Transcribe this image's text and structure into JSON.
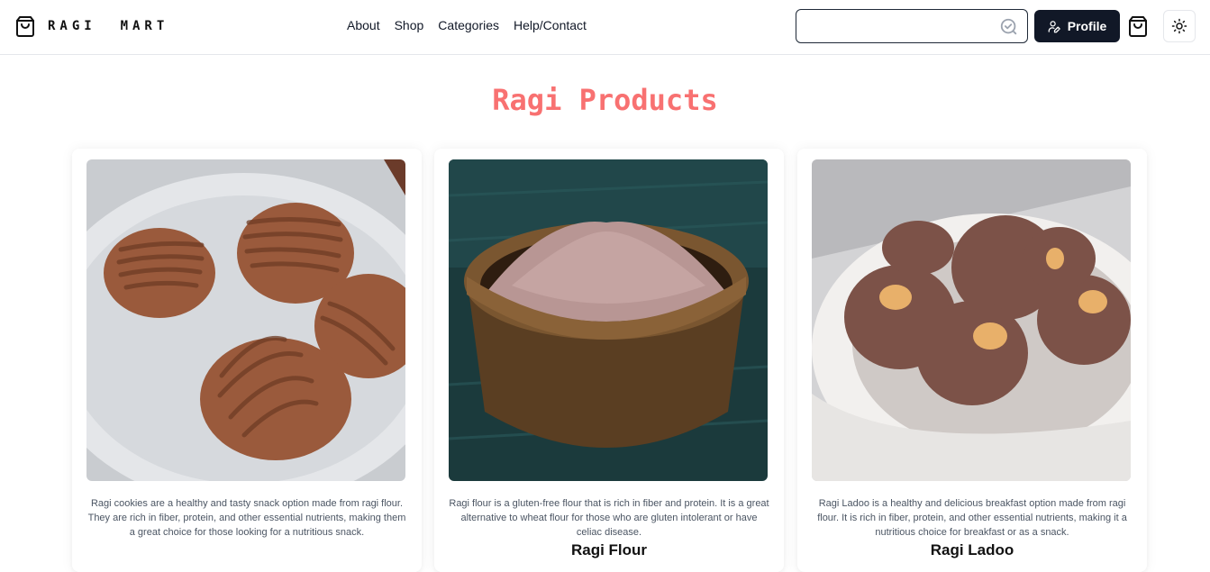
{
  "header": {
    "brand_name": "RAGI  MART",
    "brand_icon": "shopping-bag-icon",
    "nav": [
      "About",
      "Shop",
      "Categories",
      "Help/Contact"
    ],
    "search": {
      "value": "",
      "placeholder": "",
      "icon": "search-check-icon"
    },
    "profile_label": "Profile",
    "profile_icon": "user-pen-icon",
    "cart_icon": "shopping-bag-icon",
    "theme_icon": "sun-icon"
  },
  "main": {
    "title": "Ragi Products",
    "title_color": "#f87171",
    "products": [
      {
        "name": "",
        "image": "ragi-cookies-photo",
        "description": "Ragi cookies are a healthy and tasty snack option made from ragi flour. They are rich in fiber, protein, and other essential nutrients, making them a great choice for those looking for a nutritious snack."
      },
      {
        "name": "Ragi Flour",
        "image": "ragi-flour-photo",
        "description": "Ragi flour is a gluten-free flour that is rich in fiber and protein. It is a great alternative to wheat flour for those who are gluten intolerant or have celiac disease."
      },
      {
        "name": "Ragi Ladoo",
        "image": "ragi-ladoo-photo",
        "description": "Ragi Ladoo is a healthy and delicious breakfast option made from ragi flour. It is rich in fiber, protein, and other essential nutrients, making it a nutritious choice for breakfast or as a snack."
      }
    ]
  },
  "colors": {
    "primary_button": "#111827",
    "accent": "#f87171",
    "border": "#e5e7eb"
  }
}
